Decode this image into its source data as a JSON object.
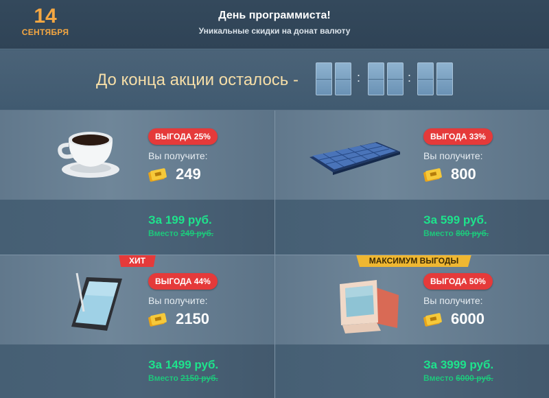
{
  "header": {
    "date_day": "14",
    "date_month": "СЕНТЯБРЯ",
    "title": "День программиста!",
    "subtitle": "Уникальные скидки на донат валюту"
  },
  "timer": {
    "label": "До конца акции осталось -",
    "separator": ":"
  },
  "offers": [
    {
      "badge": "ВЫГОДА 25%",
      "receive_label": "Вы получите:",
      "amount": "249",
      "price": "За 199 руб.",
      "old_prefix": "Вместо ",
      "old_value": "249 руб.",
      "image_icon": "coffee-cup-icon"
    },
    {
      "badge": "ВЫГОДА 33%",
      "receive_label": "Вы получите:",
      "amount": "800",
      "price": "За 599 руб.",
      "old_prefix": "Вместо ",
      "old_value": "800 руб.",
      "image_icon": "keyboard-icon"
    },
    {
      "ribbon": "ХИТ",
      "badge": "ВЫГОДА 44%",
      "receive_label": "Вы получите:",
      "amount": "2150",
      "price": "За 1499 руб.",
      "old_prefix": "Вместо ",
      "old_value": "2150 руб.",
      "image_icon": "tablet-icon"
    },
    {
      "ribbon": "МАКСИМУМ ВЫГОДЫ",
      "badge": "ВЫГОДА 50%",
      "receive_label": "Вы получите:",
      "amount": "6000",
      "price": "За 3999 руб.",
      "old_prefix": "Вместо ",
      "old_value": "6000 руб.",
      "image_icon": "computer-monitor-icon"
    }
  ],
  "colors": {
    "accent_orange": "#f5a742",
    "badge_red": "#e53a3a",
    "price_green": "#1ee38c",
    "ribbon_gold": "#efb731"
  }
}
